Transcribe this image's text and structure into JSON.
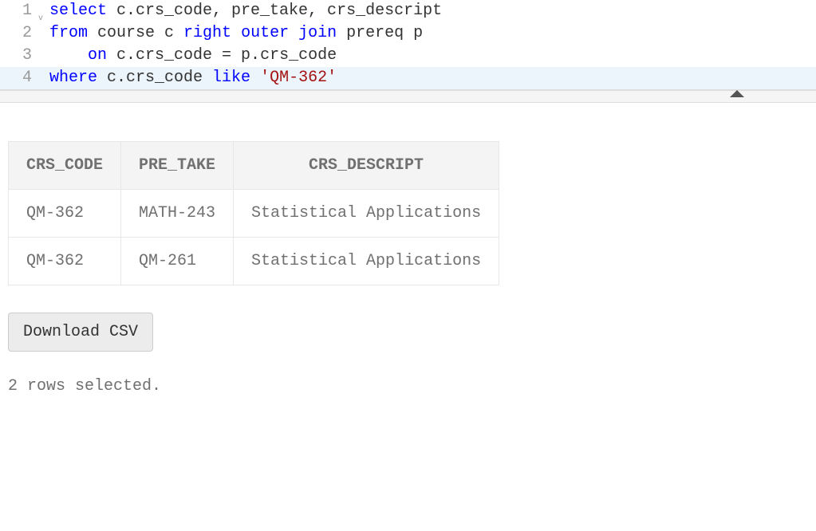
{
  "editor": {
    "lines": [
      {
        "num": "1",
        "fold": true
      },
      {
        "num": "2"
      },
      {
        "num": "3"
      },
      {
        "num": "4",
        "current": true
      }
    ],
    "line1": {
      "kw_select": "select",
      "rest": " c.crs_code, pre_take, crs_descript"
    },
    "line2": {
      "kw_from": "from",
      "mid": " course c ",
      "kw_right": "right",
      "sp1": " ",
      "kw_outer": "outer",
      "sp2": " ",
      "kw_join": "join",
      "rest": " prereq p"
    },
    "line3": {
      "indent": "    ",
      "kw_on": "on",
      "rest": " c.crs_code = p.crs_code"
    },
    "line4": {
      "kw_where": "where",
      "mid": " c.crs_code ",
      "kw_like": "like",
      "sp": " ",
      "str": "'QM-362'"
    }
  },
  "table": {
    "headers": {
      "c0": "CRS_CODE",
      "c1": "PRE_TAKE",
      "c2": "CRS_DESCRIPT"
    },
    "rows": [
      {
        "c0": "QM-362",
        "c1": "MATH-243",
        "c2": "Statistical Applications"
      },
      {
        "c0": "QM-362",
        "c1": "QM-261",
        "c2": "Statistical Applications"
      }
    ]
  },
  "buttons": {
    "download": "Download CSV"
  },
  "status": "2 rows selected."
}
